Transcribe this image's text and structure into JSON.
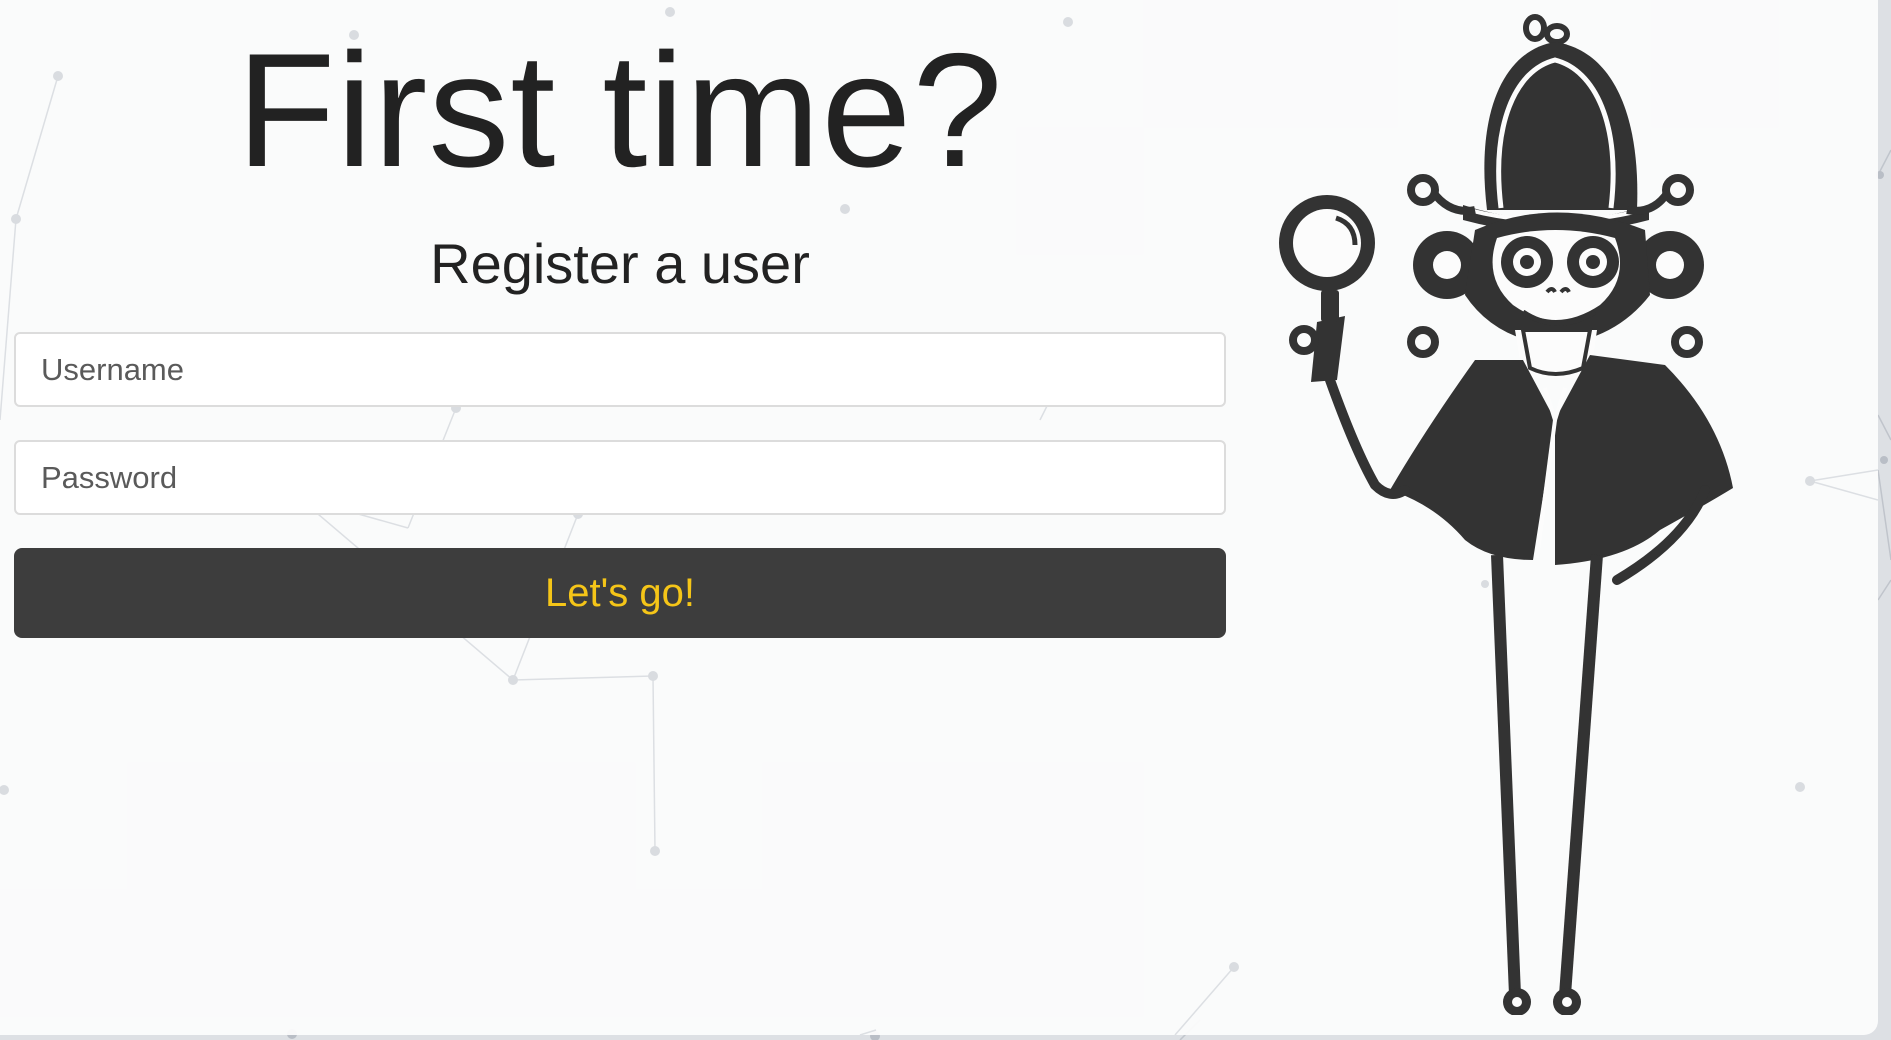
{
  "page": {
    "title": "First time?",
    "subtitle": "Register a user"
  },
  "form": {
    "username_placeholder": "Username",
    "password_placeholder": "Password",
    "submit_label": "Let's go!"
  },
  "mascot": {
    "icon": "detective-monkey-icon"
  },
  "colors": {
    "button_bg": "#3d3d3d",
    "button_text": "#f5c518",
    "mascot": "#333333",
    "text": "#222222"
  }
}
